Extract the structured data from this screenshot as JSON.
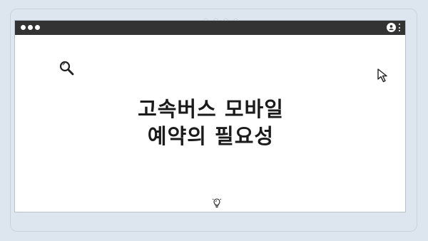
{
  "headline": {
    "line1": "고속버스 모바일",
    "line2": "예약의 필요성"
  },
  "icons": {
    "search": "search-icon",
    "cursor": "cursor-icon",
    "lightbulb": "lightbulb-icon",
    "profile": "profile-icon",
    "menu": "kebab-menu-icon"
  },
  "colors": {
    "background": "#dde5ee",
    "titlebar": "#333333",
    "window": "#ffffff",
    "text": "#1b1b1b"
  }
}
